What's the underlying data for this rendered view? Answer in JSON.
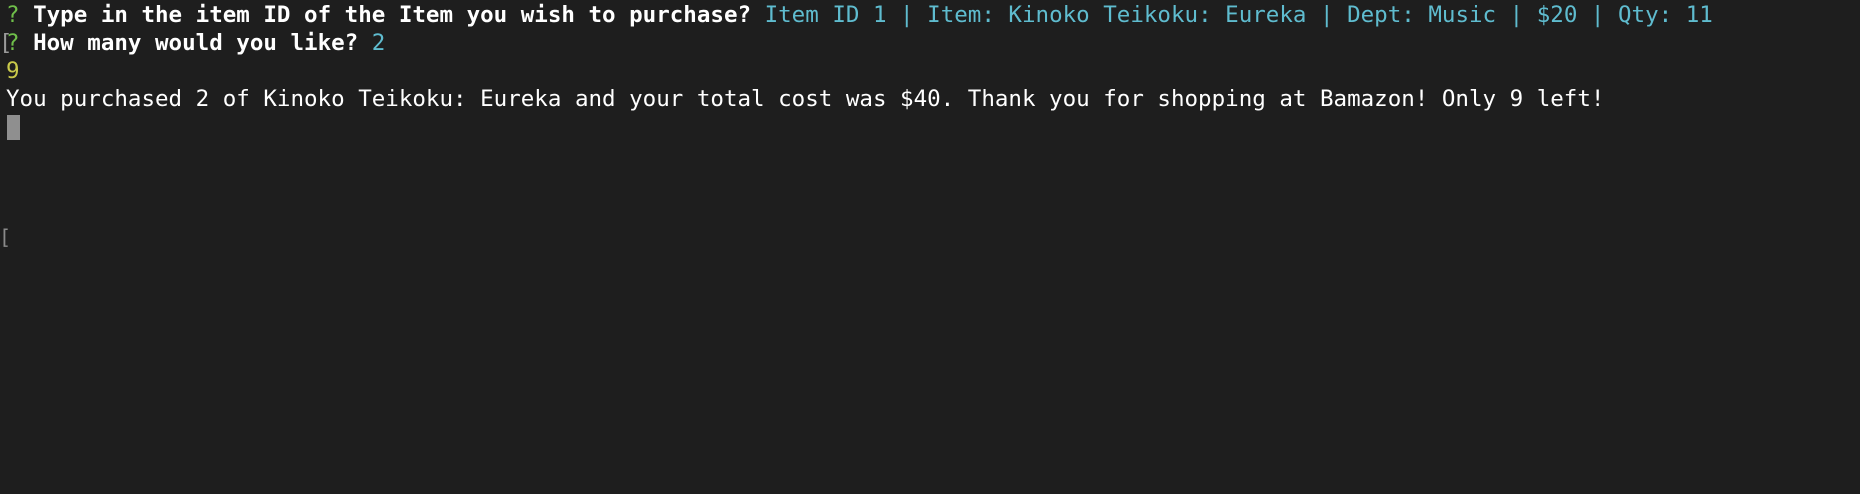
{
  "terminal": {
    "colors": {
      "background": "#1e1e1e",
      "prompt_mark": "#6fbf4a",
      "answer": "#5fbccf",
      "echo": "#c9c94a",
      "output": "#ffffff",
      "cursor": "#8f8f8f"
    },
    "lines": [
      {
        "mark": "?",
        "question": "Type in the item ID of the Item you wish to purchase?",
        "answer": "Item ID 1 | Item: Kinoko Teikoku: Eureka | Dept: Music | $20 | Qty: 11"
      },
      {
        "bracket": "[",
        "mark": "?",
        "question": "How many would you like?",
        "answer": "2"
      },
      {
        "echo": "9"
      },
      {
        "output": "You purchased 2 of Kinoko Teikoku: Eureka and your total cost was $40. Thank you for shopping at Bamazon! Only 9 left!"
      }
    ],
    "margin_mark": "["
  }
}
